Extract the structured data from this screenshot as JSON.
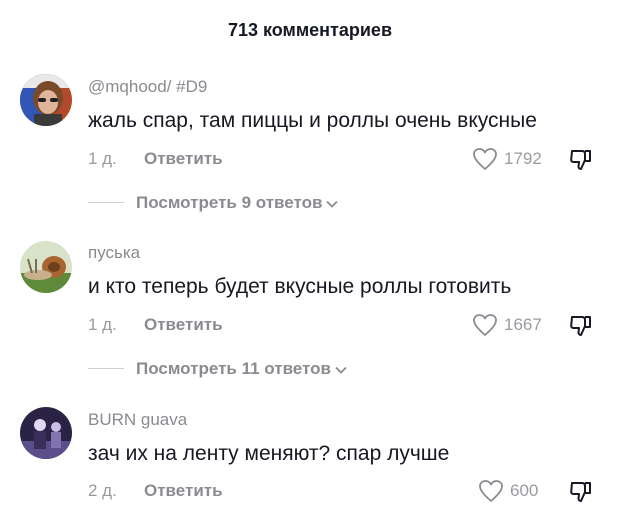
{
  "header": {
    "title": "713 комментариев"
  },
  "comments": [
    {
      "username": "@mqhood/ #D9",
      "text": "жаль спар, там пиццы и роллы очень вкусные",
      "date": "1 д.",
      "reply_label": "Ответить",
      "likes": "1792",
      "view_replies": "Посмотреть 9 ответов"
    },
    {
      "username": "пуська",
      "text": "и кто теперь будет вкусные роллы готовить",
      "date": "1 д.",
      "reply_label": "Ответить",
      "likes": "1667",
      "view_replies": "Посмотреть 11 ответов"
    },
    {
      "username": "BURN guava",
      "text": "зач их на ленту меняют? спар лучше",
      "date": "2 д.",
      "reply_label": "Ответить",
      "likes": "600"
    }
  ],
  "icons": {
    "like": "heart-outline-icon",
    "dislike": "thumbs-down-icon",
    "expand": "chevron-down-icon"
  },
  "colors": {
    "text_primary": "#161823",
    "text_secondary": "#8a8b91",
    "divider": "#cfd0d4"
  }
}
